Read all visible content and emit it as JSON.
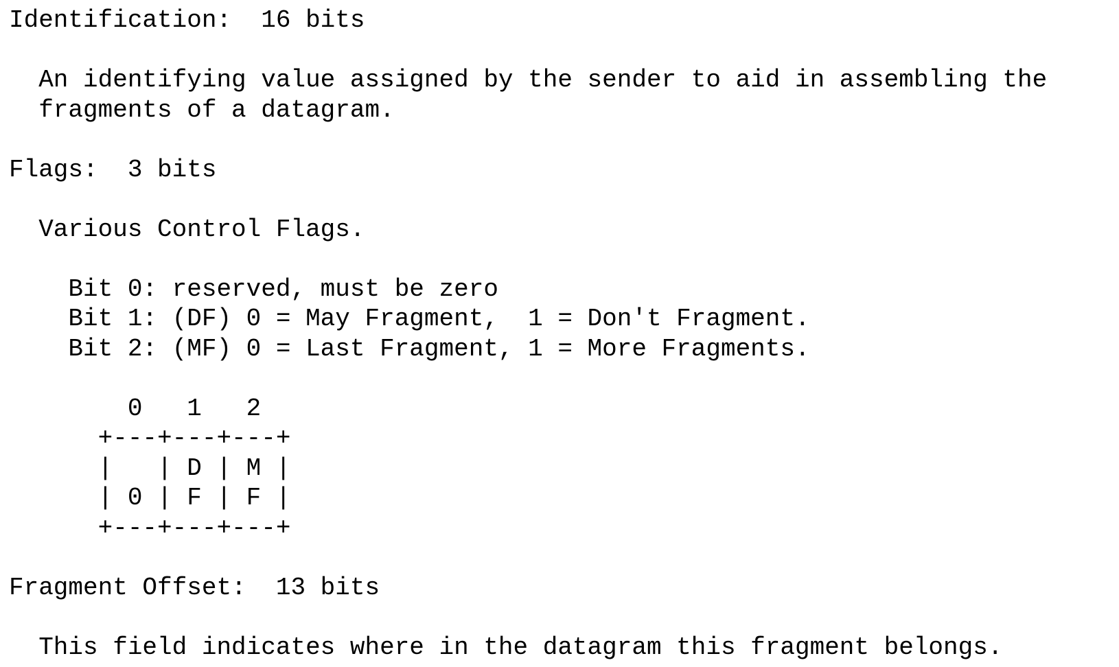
{
  "document": {
    "lines": [
      "Identification:  16 bits",
      "",
      "  An identifying value assigned by the sender to aid in assembling the",
      "  fragments of a datagram.",
      "",
      "Flags:  3 bits",
      "",
      "  Various Control Flags.",
      "",
      "    Bit 0: reserved, must be zero",
      "    Bit 1: (DF) 0 = May Fragment,  1 = Don't Fragment.",
      "    Bit 2: (MF) 0 = Last Fragment, 1 = More Fragments.",
      "",
      "        0   1   2",
      "      +---+---+---+",
      "      |   | D | M |",
      "      | 0 | F | F |",
      "      +---+---+---+",
      "",
      "Fragment Offset:  13 bits",
      "",
      "  This field indicates where in the datagram this fragment belongs."
    ]
  }
}
